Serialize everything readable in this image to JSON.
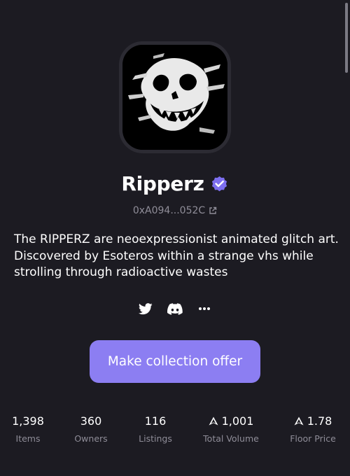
{
  "collection": {
    "name": "Ripperz",
    "verified": true,
    "address": "0xA094...052C",
    "description": "The RIPPERZ are neoexpressionist animated glitch art. Discovered by Esoteros within a strange vhs while strolling through radioactive wastes",
    "avatar_icon": "skull-glitch-art"
  },
  "socials": [
    {
      "icon": "twitter-icon"
    },
    {
      "icon": "discord-icon"
    },
    {
      "icon": "more-icon"
    }
  ],
  "actions": {
    "offer_label": "Make collection offer"
  },
  "stats": [
    {
      "value": "1,398",
      "label": "Items"
    },
    {
      "value": "360",
      "label": "Owners"
    },
    {
      "value": "116",
      "label": "Listings"
    },
    {
      "value": "1,001",
      "label": "Total Volume",
      "currency_icon": "ethereum-icon"
    },
    {
      "value": "1.78",
      "label": "Floor Price",
      "currency_icon": "ethereum-icon"
    }
  ],
  "colors": {
    "background": "#1c1b22",
    "accent": "#8c7ef2",
    "muted_text": "#8f8d98"
  }
}
